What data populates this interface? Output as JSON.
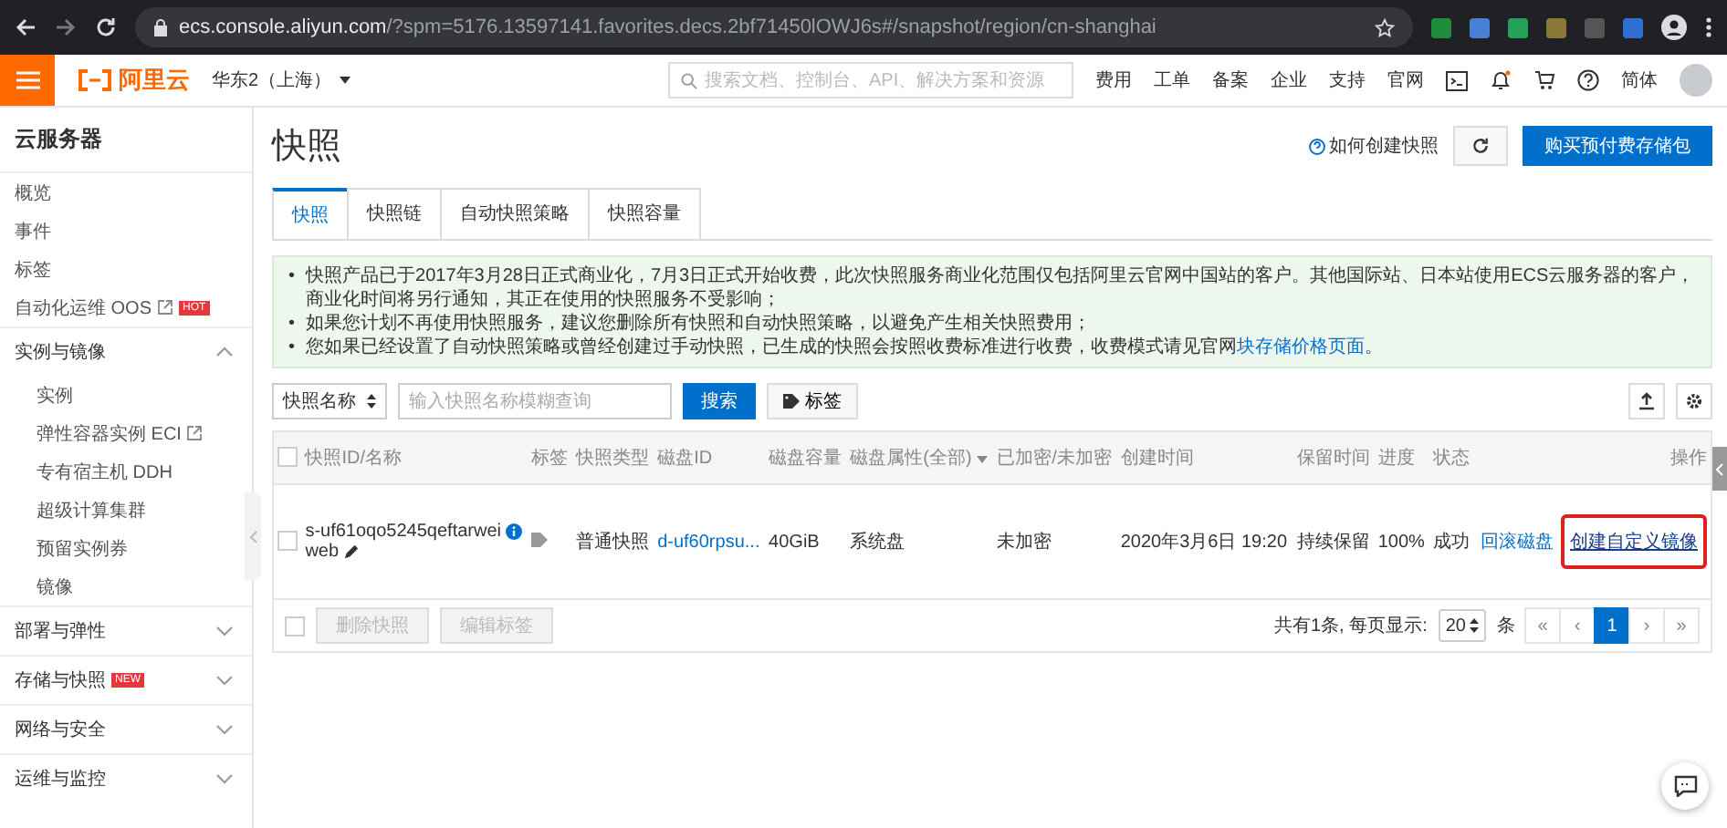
{
  "browser": {
    "host": "ecs.console.aliyun.com",
    "path": "/?spm=5176.13597141.favorites.decs.2bf71450lOWJ6s#/snapshot/region/cn-shanghai"
  },
  "topnav": {
    "logo": "阿里云",
    "region": "华东2（上海）",
    "search_placeholder": "搜索文档、控制台、API、解决方案和资源",
    "links": [
      "费用",
      "工单",
      "备案",
      "企业",
      "支持",
      "官网"
    ],
    "language": "简体"
  },
  "sidebar": {
    "title": "云服务器",
    "items": [
      {
        "label": "概览",
        "external": false
      },
      {
        "label": "事件",
        "external": false
      },
      {
        "label": "标签",
        "external": false
      },
      {
        "label": "自动化运维 OOS",
        "external": true,
        "badge": "HOT"
      }
    ],
    "groups": [
      {
        "label": "实例与镜像",
        "expanded": true,
        "children": [
          {
            "label": "实例",
            "external": false
          },
          {
            "label": "弹性容器实例 ECI",
            "external": true
          },
          {
            "label": "专有宿主机 DDH",
            "external": false
          },
          {
            "label": "超级计算集群",
            "external": false
          },
          {
            "label": "预留实例券",
            "external": false
          },
          {
            "label": "镜像",
            "external": false
          }
        ]
      },
      {
        "label": "部署与弹性",
        "expanded": false
      },
      {
        "label": "存储与快照",
        "expanded": false,
        "badge": "NEW"
      },
      {
        "label": "网络与安全",
        "expanded": false
      },
      {
        "label": "运维与监控",
        "expanded": false
      }
    ]
  },
  "page": {
    "title": "快照",
    "help_link": "如何创建快照",
    "buy_button": "购买预付费存储包",
    "tabs": [
      {
        "label": "快照",
        "selected": true
      },
      {
        "label": "快照链",
        "selected": false
      },
      {
        "label": "自动快照策略",
        "selected": false
      },
      {
        "label": "快照容量",
        "selected": false
      }
    ],
    "notices": [
      {
        "bullet": "•",
        "text": "快照产品已于2017年3月28日正式商业化，7月3日正式开始收费，此次快照服务商业化范围仅包括阿里云官网中国站的客户。其他国际站、日本站使用ECS云服务器的客户，商业化时间将另行通知，其正在使用的快照服务不受影响；"
      },
      {
        "bullet": "•",
        "text": "如果您计划不再使用快照服务，建议您删除所有快照和自动快照策略，以避免产生相关快照费用；"
      },
      {
        "bullet": "•",
        "text": "您如果已经设置了自动快照策略或曾经创建过手动快照，已生成的快照会按照收费标准进行收费，收费模式请见官网",
        "link": "块存储价格页面",
        "after": "。"
      }
    ],
    "filter": {
      "select": "快照名称",
      "placeholder": "输入快照名称模糊查询",
      "search_button": "搜索",
      "tag_button": "标签"
    },
    "table": {
      "all_selected": false,
      "columns": [
        {
          "label": "快照ID/名称",
          "dropdown": false
        },
        {
          "label": "标签",
          "dropdown": false
        },
        {
          "label": "快照类型",
          "dropdown": false
        },
        {
          "label": "磁盘ID",
          "dropdown": false
        },
        {
          "label": "磁盘容量",
          "dropdown": false
        },
        {
          "label": "磁盘属性(全部)",
          "dropdown": true
        },
        {
          "label": "已加密/未加密",
          "dropdown": false
        },
        {
          "label": "创建时间",
          "dropdown": false
        },
        {
          "label": "保留时间",
          "dropdown": false
        },
        {
          "label": "进度",
          "dropdown": false
        },
        {
          "label": "状态",
          "dropdown": false
        },
        {
          "label": "操作",
          "dropdown": false
        }
      ],
      "rows": [
        {
          "selected": false,
          "id": "s-uf61oqo5245qeftarwei",
          "name": "web",
          "type": "普通快照",
          "disk_id": "d-uf60rpsu...",
          "capacity": "40GiB",
          "attribute": "系统盘",
          "encryption": "未加密",
          "created": "2020年3月6日 19:20",
          "retention": "持续保留",
          "progress": "100%",
          "status": "成功",
          "actions": [
            {
              "label": "回滚磁盘",
              "highlighted": false
            },
            {
              "label": "创建自定义镜像",
              "highlighted": true
            }
          ]
        }
      ]
    },
    "footer": {
      "selected": false,
      "buttons": [
        {
          "label": "删除快照",
          "disabled": true
        },
        {
          "label": "编辑标签",
          "disabled": true
        }
      ],
      "total": "共有1条, 每页显示:",
      "page_size": "20",
      "unit": "条",
      "pages": [
        {
          "label": "«",
          "selected": false
        },
        {
          "label": "‹",
          "selected": false
        },
        {
          "label": "1",
          "selected": true
        },
        {
          "label": "›",
          "selected": false
        },
        {
          "label": "»",
          "selected": false
        }
      ]
    }
  }
}
